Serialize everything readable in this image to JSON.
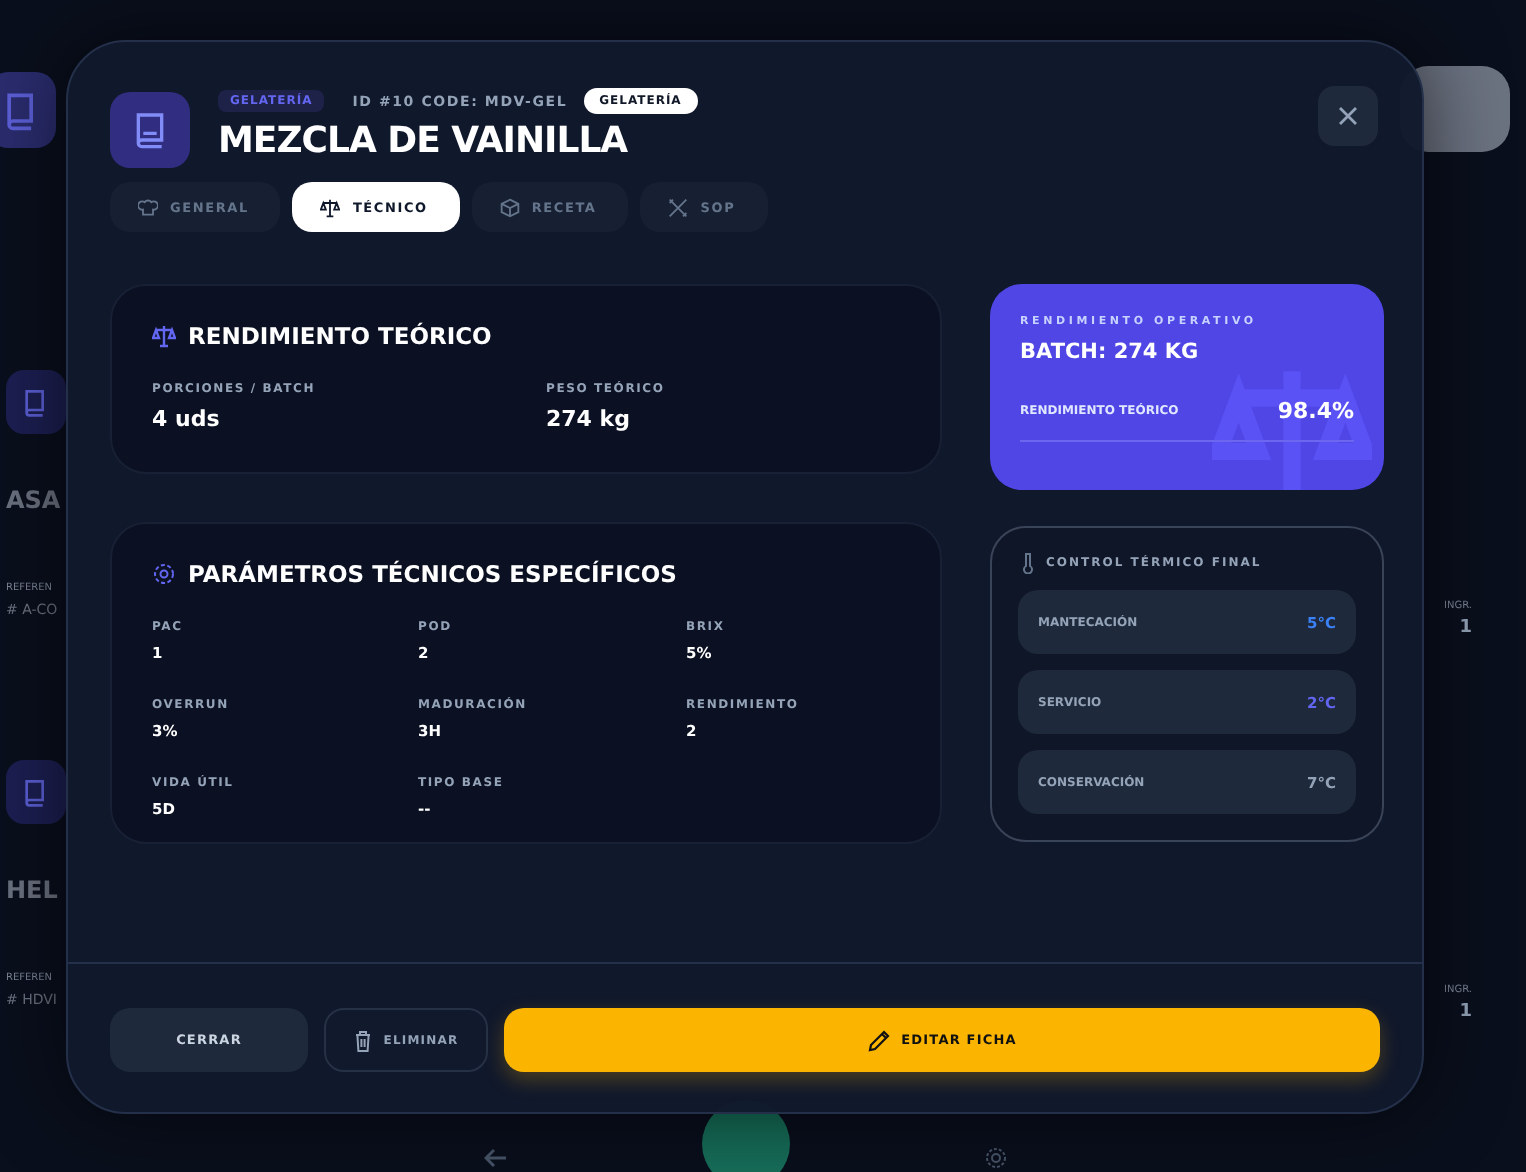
{
  "background": {
    "left_cards": [
      {
        "ref_label": "REFEREN",
        "title": "ASA",
        "ref": "# A-CO"
      },
      {
        "ref_label": "REFEREN",
        "title": "HEL",
        "ref": "# HDVI"
      }
    ],
    "right_cards": [
      {
        "label": "INGR.",
        "value": "1"
      },
      {
        "label": "INGR.",
        "value": "1"
      }
    ]
  },
  "header": {
    "category": "GELATERÍA",
    "meta": "ID #10 CODE: MDV-GEL",
    "badge": "GELATERÍA",
    "title": "MEZCLA DE VAINILLA"
  },
  "tabs": [
    {
      "label": "GENERAL",
      "selected": false
    },
    {
      "label": "TÉCNICO",
      "selected": true
    },
    {
      "label": "RECETA",
      "selected": false
    },
    {
      "label": "SOP",
      "selected": false
    }
  ],
  "yield_card": {
    "title": "RENDIMIENTO TEÓRICO",
    "fields": [
      {
        "label": "PORCIONES / BATCH",
        "value": "4 uds"
      },
      {
        "label": "PESO TEÓRICO",
        "value": "274 kg"
      }
    ]
  },
  "params_card": {
    "title": "PARÁMETROS TÉCNICOS ESPECÍFICOS",
    "fields": [
      {
        "label": "PAC",
        "value": "1"
      },
      {
        "label": "POD",
        "value": "2"
      },
      {
        "label": "BRIX",
        "value": "5%"
      },
      {
        "label": "OVERRUN",
        "value": "3%"
      },
      {
        "label": "MADURACIÓN",
        "value": "3H"
      },
      {
        "label": "RENDIMIENTO",
        "value": "2"
      },
      {
        "label": "VIDA ÚTIL",
        "value": "5D"
      },
      {
        "label": "TIPO BASE",
        "value": "--"
      }
    ]
  },
  "operative_card": {
    "label": "RENDIMIENTO OPERATIVO",
    "batch": "BATCH: 274 KG",
    "metric_label": "RENDIMIENTO TEÓRICO",
    "metric_value": "98.4%"
  },
  "thermal": {
    "title": "CONTROL TÉRMICO FINAL",
    "rows": [
      {
        "label": "MANTECACIÓN",
        "value": "5°C",
        "color": "#3b82f6"
      },
      {
        "label": "SERVICIO",
        "value": "2°C",
        "color": "#6366f1"
      },
      {
        "label": "CONSERVACIÓN",
        "value": "7°C",
        "color": "#94a3b8"
      }
    ]
  },
  "footer": {
    "buttons": [
      {
        "label": "CERRAR",
        "kind": "secondary"
      },
      {
        "label": "ELIMINAR",
        "kind": "danger"
      },
      {
        "label": "EDITAR FICHA",
        "kind": "primary"
      }
    ]
  }
}
